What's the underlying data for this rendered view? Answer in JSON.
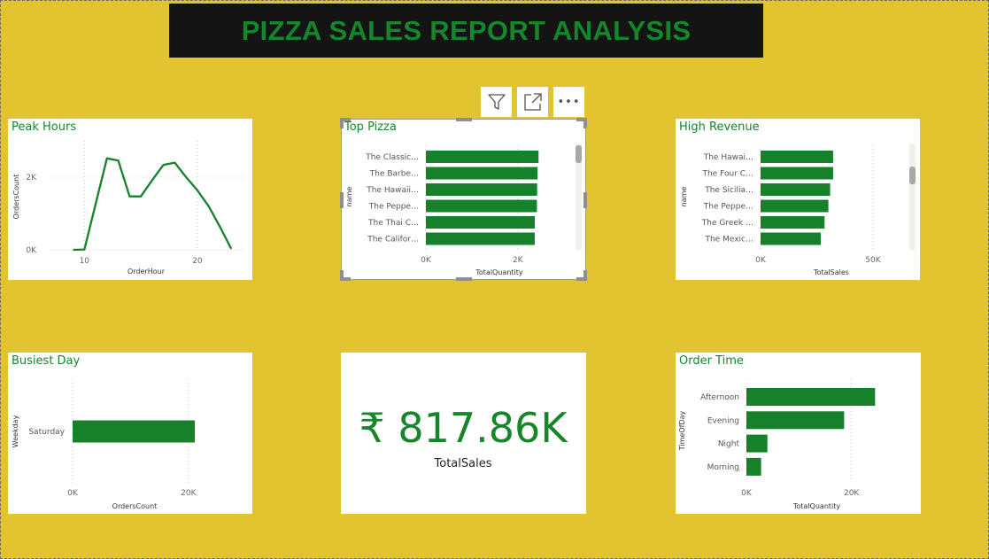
{
  "report": {
    "title": "PIZZA SALES REPORT ANALYSIS"
  },
  "toolbar": {
    "icons": [
      "filter-icon",
      "focus-mode-icon",
      "more-options-icon"
    ],
    "more_label": "•••"
  },
  "colors": {
    "background": "#e2c330",
    "bar": "#16812a",
    "title_text": "#16862a",
    "title_bg": "#141414"
  },
  "kpi": {
    "value": "₹ 817.86K",
    "label": "TotalSales"
  },
  "chart_data": [
    {
      "id": "peak_hours",
      "type": "line",
      "title": "Peak Hours",
      "xlabel": "OrderHour",
      "ylabel": "OrdersCount",
      "x": [
        9,
        10,
        12,
        13,
        14,
        15,
        16,
        17,
        18,
        19,
        20,
        21,
        22,
        23
      ],
      "values": [
        1,
        10,
        2520,
        2455,
        1470,
        1470,
        1920,
        2340,
        2400,
        2000,
        1640,
        1200,
        630,
        30
      ],
      "xlim": [
        7,
        24
      ],
      "ylim": [
        0,
        3000
      ],
      "xticks": [
        10,
        20
      ],
      "xtick_labels": [
        "10",
        "20"
      ],
      "yticks": [
        0,
        2000
      ],
      "ytick_labels": [
        "0K",
        "2K"
      ],
      "grid": true
    },
    {
      "id": "top_pizza",
      "type": "bar",
      "orientation": "horizontal",
      "title": "Top Pizza",
      "xlabel": "TotalQuantity",
      "ylabel": "name",
      "categories": [
        "The Classic…",
        "The Barbe…",
        "The Hawaii…",
        "The Peppe…",
        "The Thai C…",
        "The Califor…"
      ],
      "values": [
        2453,
        2432,
        2422,
        2418,
        2371,
        2370
      ],
      "xlim": [
        0,
        3200
      ],
      "xticks": [
        0,
        2000
      ],
      "xtick_labels": [
        "0K",
        "2K"
      ],
      "grid": true
    },
    {
      "id": "high_revenue",
      "type": "bar",
      "orientation": "horizontal",
      "title": "High Revenue",
      "xlabel": "TotalSales",
      "ylabel": "name",
      "categories": [
        "The Hawai…",
        "The Four C…",
        "The Sicilia…",
        "The Peppe…",
        "The Greek …",
        "The Mexic…"
      ],
      "values": [
        32273,
        32265,
        30940,
        30161,
        28454,
        26780
      ],
      "xlim": [
        0,
        63000
      ],
      "xticks": [
        0,
        50000
      ],
      "xtick_labels": [
        "0K",
        "50K"
      ],
      "grid": true
    },
    {
      "id": "busiest_day",
      "type": "bar",
      "orientation": "horizontal",
      "title": "Busiest Day",
      "xlabel": "OrdersCount",
      "ylabel": "Weekday",
      "categories": [
        "Saturday"
      ],
      "values": [
        21100
      ],
      "xlim": [
        0,
        21400
      ],
      "xticks": [
        0,
        20000
      ],
      "xtick_labels": [
        "0K",
        "20K"
      ],
      "grid": true
    },
    {
      "id": "order_time",
      "type": "bar",
      "orientation": "horizontal",
      "title": "Order Time",
      "xlabel": "TotalQuantity",
      "ylabel": "TimeOfDay",
      "categories": [
        "Afternoon",
        "Evening",
        "Night",
        "Morning"
      ],
      "values": [
        24500,
        18600,
        4000,
        2800
      ],
      "xlim": [
        0,
        26800
      ],
      "xticks": [
        0,
        20000
      ],
      "xtick_labels": [
        "0K",
        "20K"
      ],
      "grid": true
    }
  ]
}
